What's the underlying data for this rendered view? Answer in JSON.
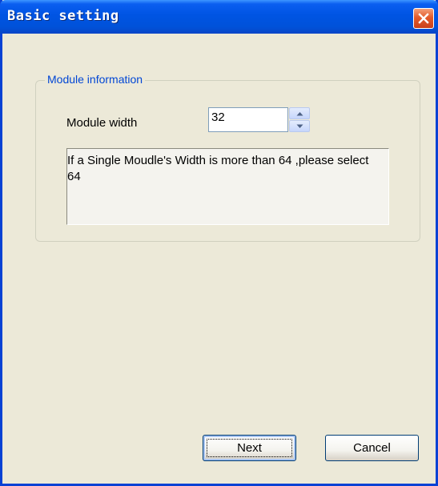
{
  "window": {
    "title": "Basic setting"
  },
  "group": {
    "legend": "Module information",
    "module_width": {
      "label": "Module width",
      "value": "32"
    },
    "info_text": "If a Single Moudle's Width is more than 64 ,please select 64"
  },
  "buttons": {
    "next_label": "Next",
    "cancel_label": "Cancel"
  },
  "colors": {
    "title_bar": "#0054e3",
    "close_button": "#e45a2a",
    "legend_text": "#0046d5",
    "window_background": "#ece9d8"
  },
  "icons": [
    "close-icon",
    "spin-up-arrow-icon",
    "spin-down-arrow-icon"
  ]
}
